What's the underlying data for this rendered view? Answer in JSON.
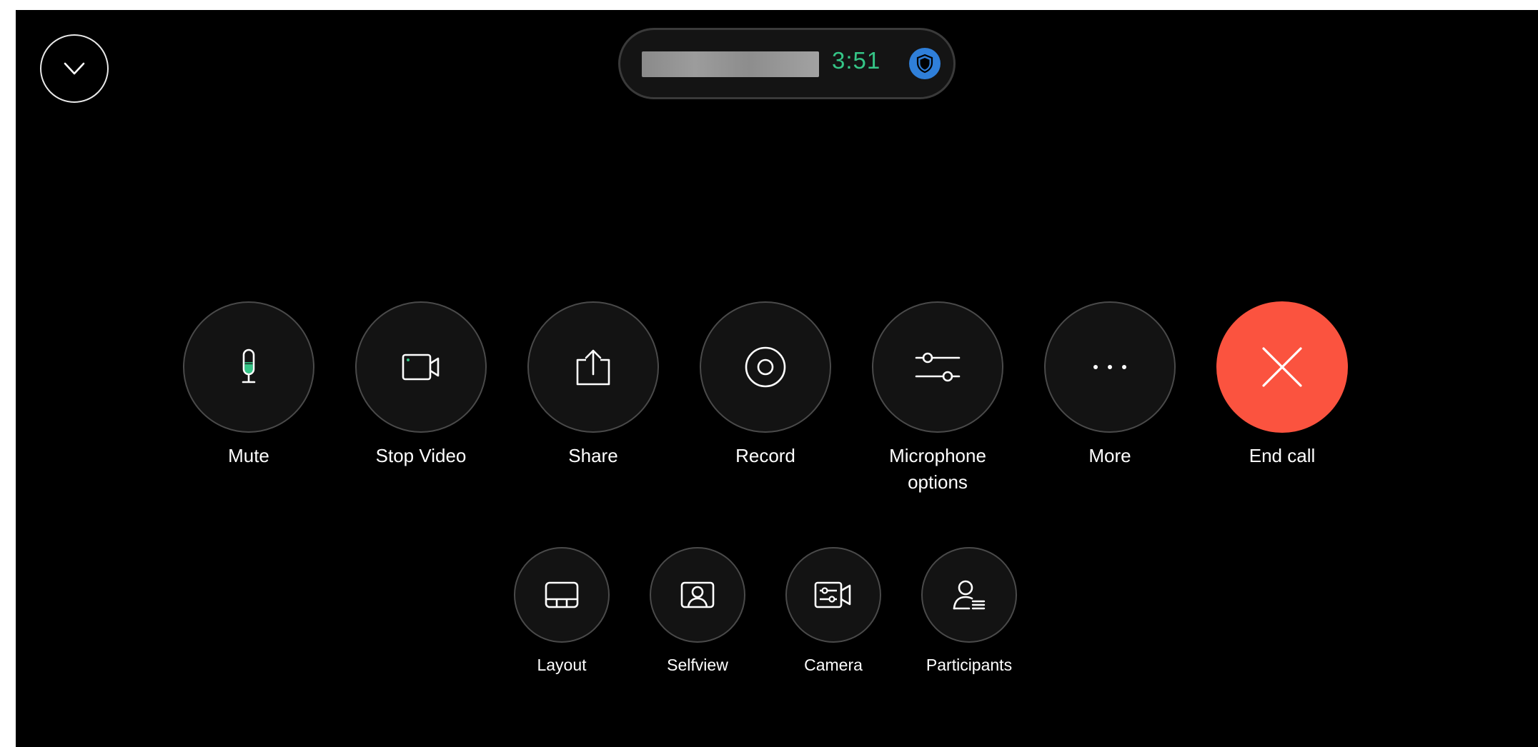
{
  "call": {
    "timer": "3:51"
  },
  "icons": {
    "collapse": "chevron-down-icon",
    "secure": "shield-icon"
  },
  "controls": {
    "primary": [
      {
        "label": "Mute",
        "icon": "microphone-icon"
      },
      {
        "label": "Stop Video",
        "icon": "video-camera-icon"
      },
      {
        "label": "Share",
        "icon": "share-icon"
      },
      {
        "label": "Record",
        "icon": "record-icon"
      },
      {
        "label": "Microphone options",
        "icon": "sliders-icon"
      },
      {
        "label": "More",
        "icon": "more-icon"
      },
      {
        "label": "End call",
        "icon": "close-icon"
      }
    ],
    "secondary": [
      {
        "label": "Layout",
        "icon": "layout-icon"
      },
      {
        "label": "Selfview",
        "icon": "selfview-icon"
      },
      {
        "label": "Camera",
        "icon": "camera-settings-icon"
      },
      {
        "label": "Participants",
        "icon": "participants-icon"
      }
    ]
  },
  "colors": {
    "background": "#000000",
    "timer": "#35c587",
    "end_call": "#fb533f",
    "secure_badge": "#2f7fd9",
    "mic_level": "#35c587"
  }
}
